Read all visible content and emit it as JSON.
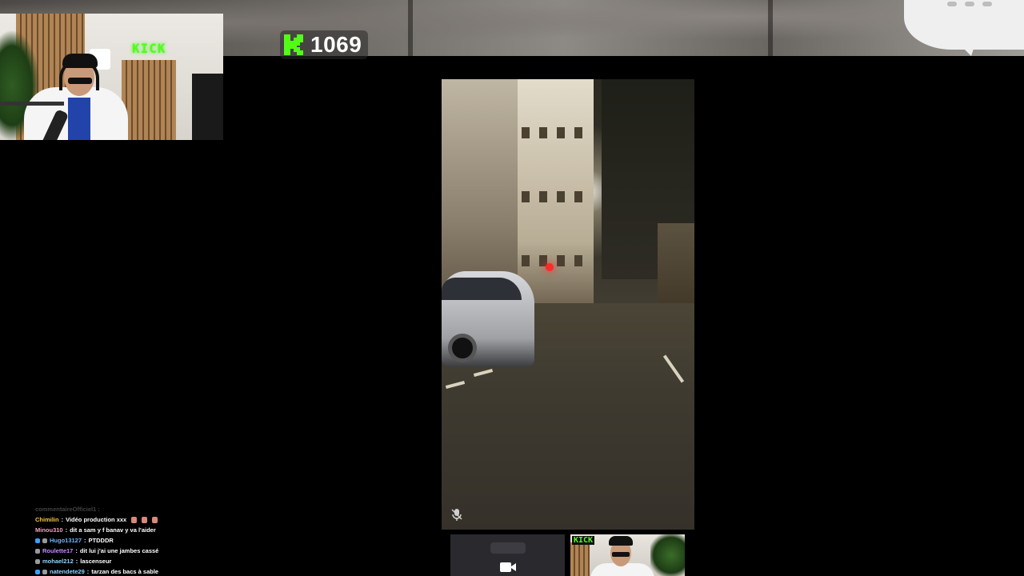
{
  "stream": {
    "viewer_count": "1069",
    "brand_color": "#53fc18",
    "kick_sign_text": "KICK"
  },
  "icons": {
    "viewer": "kick-logo-icon",
    "video_overlay": "mic-muted-icon",
    "tile_placeholder": "camera-icon"
  },
  "chat": {
    "header": "commentaireOfficiel1 :",
    "messages": [
      {
        "user": "Chimilin",
        "user_color": "#f5c542",
        "badges": [],
        "text": "Vidéo production xxx",
        "emotes": 3
      },
      {
        "user": "Minou310",
        "user_color": "#f7a0c0",
        "badges": [],
        "text": "dit a sam y f banav y va l'aider",
        "emotes": 0
      },
      {
        "user": "Hugo13127",
        "user_color": "#6fb6ff",
        "badges": [
          "#3aa0ff",
          "#9a9a9a"
        ],
        "text": "PTDDDR",
        "emotes": 0
      },
      {
        "user": "Roulette17",
        "user_color": "#c78bff",
        "badges": [
          "#9a9a9a"
        ],
        "text": "dit lui j'ai une jambes cassé",
        "emotes": 0
      },
      {
        "user": "mohael212",
        "user_color": "#8fd3ff",
        "badges": [
          "#9a9a9a"
        ],
        "text": "lascenseur",
        "emotes": 0
      },
      {
        "user": "natendete29",
        "user_color": "#8fd3ff",
        "badges": [
          "#3aa0ff",
          "#9a9a9a"
        ],
        "text": "tarzan des bacs à sable",
        "emotes": 0
      }
    ]
  }
}
